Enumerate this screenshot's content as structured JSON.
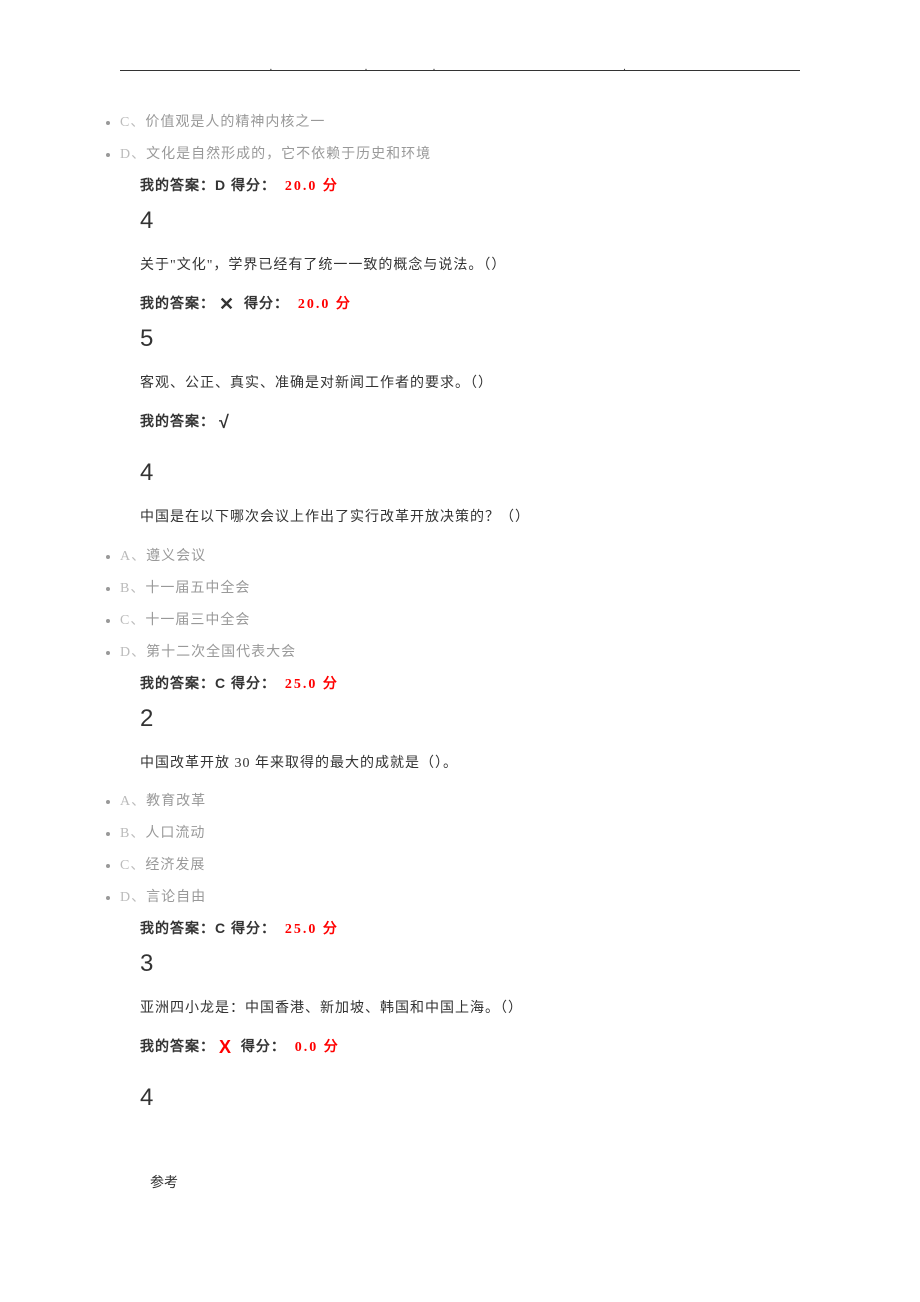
{
  "header": {
    "dots": [
      ".",
      ".",
      ".",
      "."
    ]
  },
  "items": [
    {
      "type": "option",
      "label": "C、",
      "text": "价值观是人的精神内核之一"
    },
    {
      "type": "option",
      "label": "D、",
      "text": "文化是自然形成的，它不依赖于历史和环境"
    },
    {
      "type": "answer",
      "prefix": "我的答案：",
      "key": "D",
      "score_label": "得分：",
      "score": "20.0 分"
    },
    {
      "type": "qnum",
      "num": "4"
    },
    {
      "type": "qtext",
      "text": "关于\"文化\"，学界已经有了统一一致的概念与说法。（）"
    },
    {
      "type": "answer_symbol",
      "prefix": "我的答案：",
      "symbol": "✕",
      "symbol_red": false,
      "score_label": "得分：",
      "score": "20.0 分"
    },
    {
      "type": "qnum",
      "num": "5"
    },
    {
      "type": "qtext",
      "text": "客观、公正、真实、准确是对新闻工作者的要求。（）"
    },
    {
      "type": "answer_symbol_only",
      "prefix": "我的答案：",
      "symbol": "√"
    },
    {
      "type": "gap"
    },
    {
      "type": "qnum",
      "num": "4"
    },
    {
      "type": "qtext",
      "text": "中国是在以下哪次会议上作出了实行改革开放决策的？（）"
    },
    {
      "type": "option",
      "label": "A、",
      "text": "遵义会议"
    },
    {
      "type": "option",
      "label": "B、",
      "text": "十一届五中全会"
    },
    {
      "type": "option",
      "label": "C、",
      "text": "十一届三中全会"
    },
    {
      "type": "option",
      "label": "D、",
      "text": "第十二次全国代表大会"
    },
    {
      "type": "answer",
      "prefix": "我的答案：",
      "key": "C",
      "score_label": "得分：",
      "score": "25.0 分"
    },
    {
      "type": "qnum",
      "num": "2"
    },
    {
      "type": "qtext",
      "text": "中国改革开放 30 年来取得的最大的成就是（）。"
    },
    {
      "type": "option",
      "label": "A、",
      "text": "教育改革"
    },
    {
      "type": "option",
      "label": "B、",
      "text": "人口流动"
    },
    {
      "type": "option",
      "label": "C、",
      "text": "经济发展"
    },
    {
      "type": "option",
      "label": "D、",
      "text": "言论自由"
    },
    {
      "type": "answer",
      "prefix": "我的答案：",
      "key": "C",
      "score_label": "得分：",
      "score": "25.0 分"
    },
    {
      "type": "qnum",
      "num": "3"
    },
    {
      "type": "qtext",
      "text": "亚洲四小龙是：中国香港、新加坡、韩国和中国上海。（）"
    },
    {
      "type": "answer_symbol",
      "prefix": "我的答案：",
      "symbol": "X",
      "symbol_red": true,
      "score_label": "得分：",
      "score": "0.0 分"
    },
    {
      "type": "gap"
    },
    {
      "type": "qnum",
      "num": "4"
    }
  ],
  "footer": {
    "ref": "参考"
  }
}
